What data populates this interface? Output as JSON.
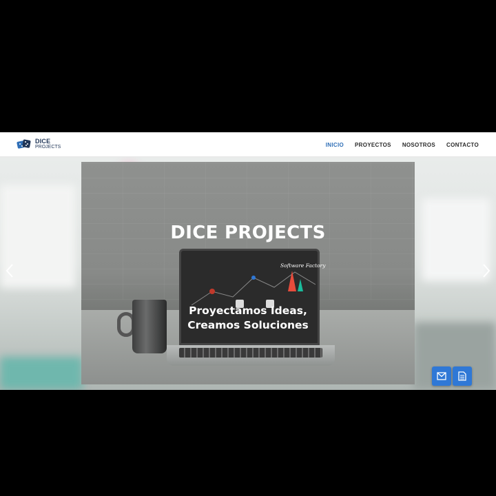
{
  "brand": {
    "logo_title": "DICE",
    "logo_subtitle": "PROJECTS",
    "logo_icon": "dice-icon",
    "colors": {
      "primary": "#1f3557",
      "accent": "#2f6fb7"
    }
  },
  "nav": {
    "items": [
      {
        "label": "INICIO",
        "active": true
      },
      {
        "label": "PROYECTOS",
        "active": false
      },
      {
        "label": "NOSOTROS",
        "active": false
      },
      {
        "label": "CONTACTO",
        "active": false
      }
    ]
  },
  "hero": {
    "title": "DICE PROJECTS",
    "subtitle_line1": "Proyectamos Ideas,",
    "subtitle_line2": "Creamos Soluciones",
    "screen_label": "Software Factory",
    "prev_icon": "chevron-left-icon",
    "next_icon": "chevron-right-icon"
  },
  "floating_buttons": [
    {
      "icon": "mail-icon",
      "color": "#2f78d6"
    },
    {
      "icon": "document-icon",
      "color": "#2f78d6"
    }
  ]
}
